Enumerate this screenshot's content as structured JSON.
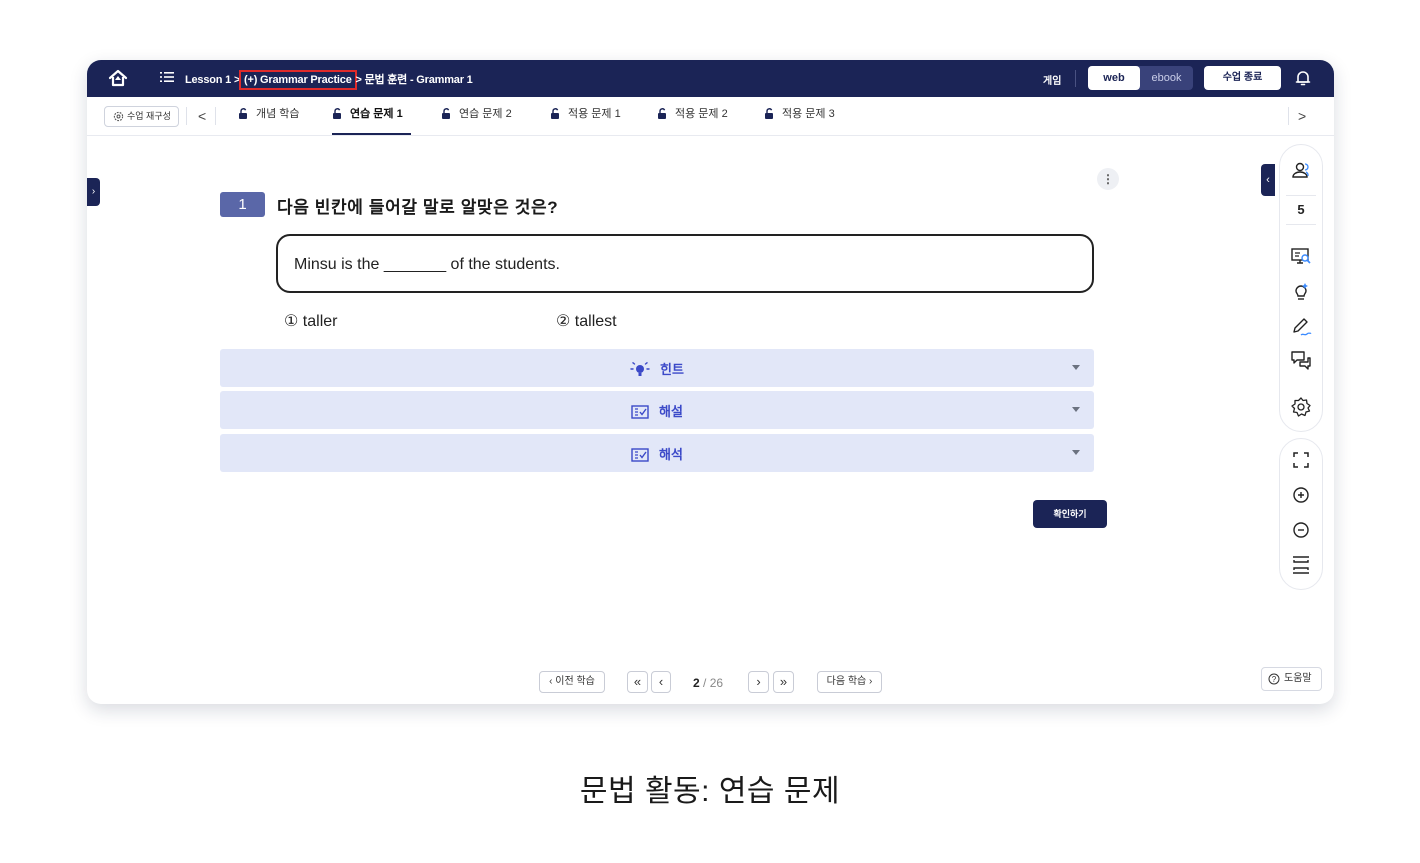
{
  "topbar": {
    "breadcrumb": {
      "lesson": "Lesson 1",
      "sep1": " > ",
      "section": "(+) Grammar Practice",
      "sep2": " > ",
      "page": "문법 훈련 - Grammar 1"
    },
    "game_label": "게임",
    "mode_web": "web",
    "mode_ebook": "ebook",
    "end_class": "수업 종료",
    "icons": [
      "home-icon",
      "list-icon",
      "bell-icon"
    ],
    "colors": {
      "bar": "#1b2456",
      "highlight": "#e02a2a"
    }
  },
  "tabbar": {
    "reconfigure": "수업 재구성",
    "prev_arrow": "<",
    "next_arrow": ">",
    "tabs": [
      {
        "label": "개념 학습",
        "active": false
      },
      {
        "label": "연습 문제 1",
        "active": true
      },
      {
        "label": "연습 문제 2",
        "active": false
      },
      {
        "label": "적용 문제 1",
        "active": false
      },
      {
        "label": "적용 문제 2",
        "active": false
      },
      {
        "label": "적용 문제 3",
        "active": false
      }
    ]
  },
  "question": {
    "number": "1",
    "title": "다음 빈칸에 들어갈 말로 알맞은 것은?",
    "sentence": "Minsu is the _______ of the students.",
    "options": [
      "① taller",
      "② tallest"
    ]
  },
  "accordions": [
    {
      "label": "힌트",
      "icon": "lightbulb-icon"
    },
    {
      "label": "해설",
      "icon": "explanation-icon"
    },
    {
      "label": "해석",
      "icon": "translation-icon"
    }
  ],
  "check_button": "확인하기",
  "side_panel": {
    "student_count": "5",
    "icons": [
      "students-icon",
      "monitor-search-icon",
      "idea-icon",
      "pen-icon",
      "chat-icon",
      "settings-icon",
      "fullscreen-icon",
      "zoom-in-icon",
      "zoom-out-icon",
      "fit-height-icon"
    ]
  },
  "pagination": {
    "prev_study": "‹ 이전 학습",
    "first": "«",
    "prev": "‹",
    "current": "2",
    "total": "/ 26",
    "next": "›",
    "last": "»",
    "next_study": "다음 학습 ›"
  },
  "help": "도움말",
  "caption": "문법 활동: 연습 문제"
}
